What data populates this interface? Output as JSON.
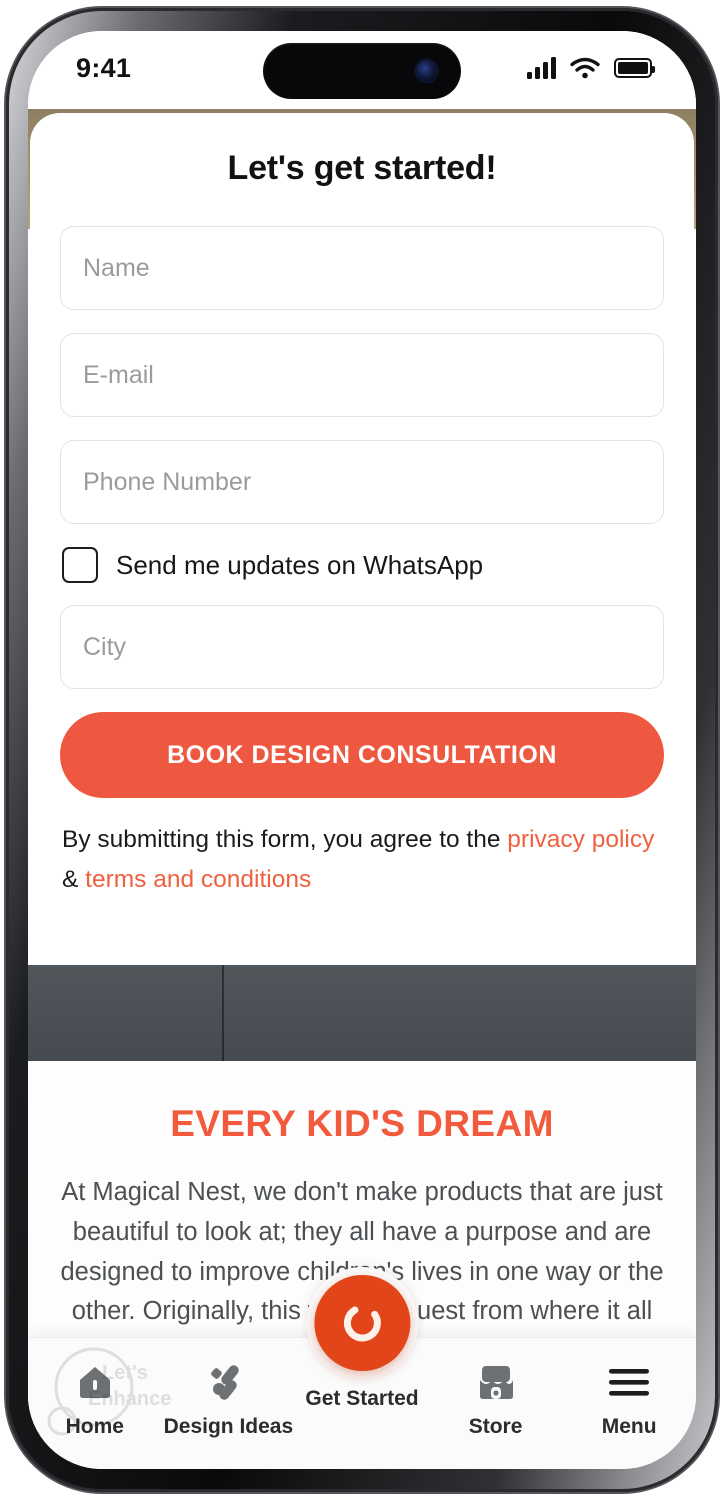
{
  "status_bar": {
    "time": "9:41",
    "icons": [
      "cellular-signal-icon",
      "wifi-icon",
      "battery-icon"
    ]
  },
  "form": {
    "title": "Let's get started!",
    "fields": [
      {
        "name": "name",
        "placeholder": "Name"
      },
      {
        "name": "email",
        "placeholder": "E-mail"
      },
      {
        "name": "phone",
        "placeholder": "Phone Number"
      },
      {
        "name": "city",
        "placeholder": "City"
      }
    ],
    "checkbox": {
      "label": "Send me updates on WhatsApp",
      "checked": false
    },
    "submit_label": "BOOK DESIGN CONSULTATION",
    "disclaimer": {
      "text_before": "By submitting this form, you agree to the ",
      "link_privacy": "privacy policy",
      "separator": " & ",
      "link_terms": "terms and conditions"
    }
  },
  "content": {
    "heading": "EVERY KID'S DREAM",
    "body": "At Magical Nest, we don't make products that are just beautiful to look at; they all have a purpose and are designed to improve children's lives in one way or the other. Originally, this was the quest from where it all began for the team at Magical Nest."
  },
  "tabbar": {
    "items": [
      {
        "label": "Home",
        "icon": "home-icon"
      },
      {
        "label": "Design Ideas",
        "icon": "design-tools-icon"
      },
      {
        "label": "Get Started",
        "icon": "nest-ring-icon"
      },
      {
        "label": "Store",
        "icon": "store-icon"
      },
      {
        "label": "Menu",
        "icon": "hamburger-menu-icon"
      }
    ]
  },
  "watermark": {
    "line1": "Let's",
    "line2": "Enhance"
  },
  "colors": {
    "accent": "#ef5840",
    "accent_heading": "#f15a3c",
    "fab": "#e2451a",
    "photo_band": "#4a5055",
    "tan_band": "#a2906d"
  }
}
